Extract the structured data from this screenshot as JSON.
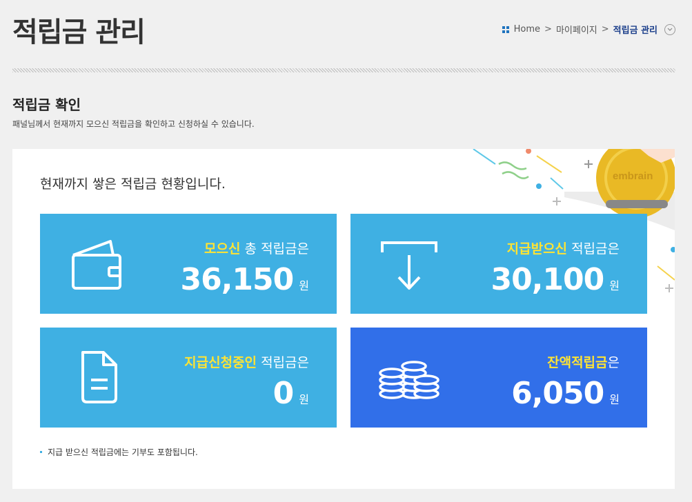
{
  "header": {
    "title": "적립금 관리",
    "breadcrumb": [
      "Home",
      "마이페이지",
      "적립금 관리"
    ]
  },
  "section": {
    "title": "적립금 확인",
    "description": "패널님께서 현재까지 모으신 적립금을 확인하고 신청하실 수 있습니다."
  },
  "panel": {
    "heading": "현재까지 쌓은 적립금 현황입니다.",
    "coin_brand": "embrain",
    "cards": [
      {
        "highlight": "모으신",
        "label": "총 적립금은",
        "amount": "36,150",
        "unit": "원",
        "icon": "wallet-icon"
      },
      {
        "highlight": "지급받으신",
        "label": "적립금은",
        "amount": "30,100",
        "unit": "원",
        "icon": "download-arrow-icon"
      },
      {
        "highlight": "지급신청중인",
        "label": "적립금은",
        "amount": "0",
        "unit": "원",
        "icon": "document-icon"
      },
      {
        "highlight": "잔액적립금",
        "label": "은",
        "amount": "6,050",
        "unit": "원",
        "icon": "coins-icon"
      }
    ],
    "note": "지급 받으신 적립금에는 기부도 포함됩니다."
  },
  "colors": {
    "card": "#3fb0e3",
    "card_balance": "#316fe9",
    "highlight": "#ffe433",
    "breadcrumb_current": "#1c3f8b"
  }
}
